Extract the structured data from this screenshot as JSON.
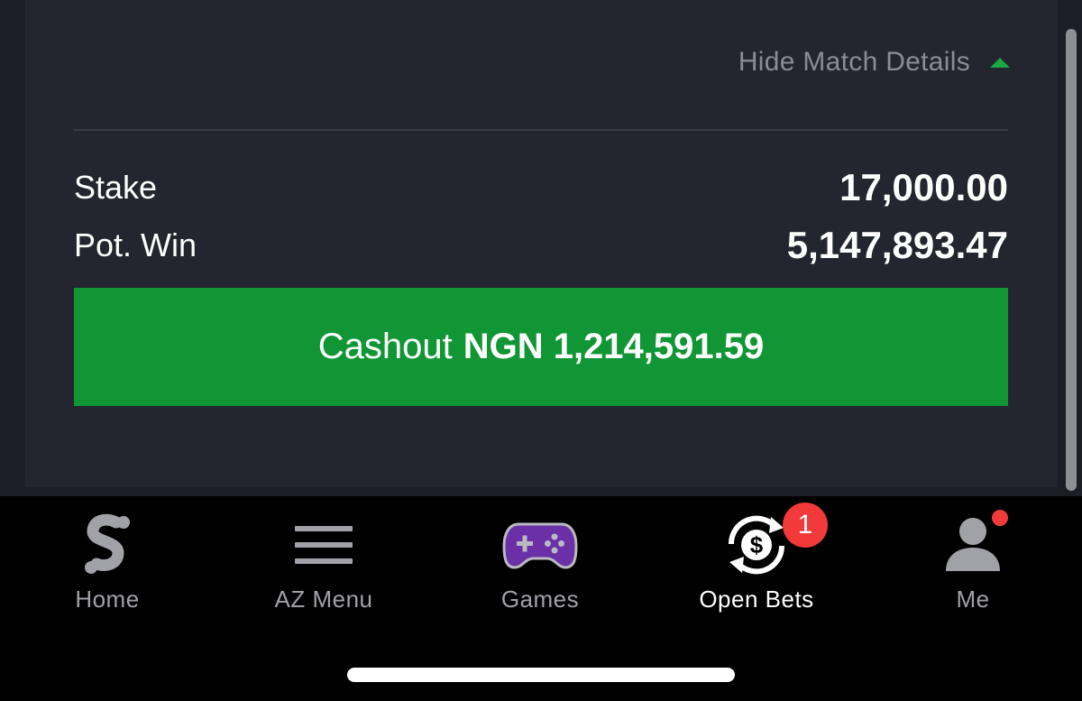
{
  "match": {
    "hide_details_label": "Hide Match Details"
  },
  "bet": {
    "stake_label": "Stake",
    "stake_value": "17,000.00",
    "potwin_label": "Pot. Win",
    "potwin_value": "5,147,893.47"
  },
  "cashout": {
    "prefix": "Cashout",
    "amount": "NGN 1,214,591.59"
  },
  "tabbar": {
    "home": "Home",
    "az_menu": "AZ Menu",
    "games": "Games",
    "open_bets": "Open Bets",
    "me": "Me",
    "open_bets_badge": "1",
    "active_tab": "Open Bets"
  },
  "icons": {
    "home": "sporty-logo-icon",
    "az_menu": "hamburger-menu-icon",
    "games": "gamepad-icon",
    "open_bets": "dollar-cycle-icon",
    "me": "user-icon"
  },
  "colors": {
    "accent_green": "#109634",
    "caret_green": "#1aa844",
    "badge_red": "#f23a3a",
    "card_bg": "#23262e"
  }
}
